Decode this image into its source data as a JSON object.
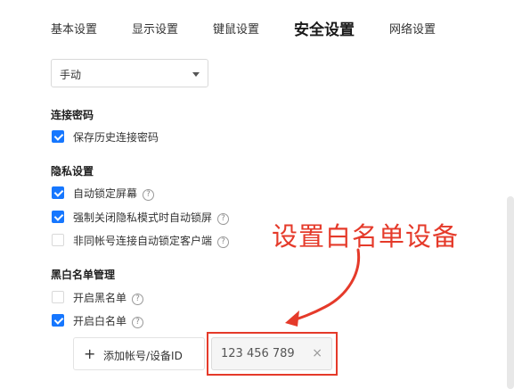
{
  "tabs": [
    {
      "label": "基本设置"
    },
    {
      "label": "显示设置"
    },
    {
      "label": "键鼠设置"
    },
    {
      "label": "安全设置"
    },
    {
      "label": "网络设置"
    }
  ],
  "mode_select": {
    "value": "手动"
  },
  "sections": {
    "connection_password": {
      "title": "连接密码",
      "items": [
        {
          "label": "保存历史连接密码",
          "checked": true
        }
      ]
    },
    "privacy": {
      "title": "隐私设置",
      "items": [
        {
          "label": "自动锁定屏幕",
          "checked": true,
          "help": "?"
        },
        {
          "label": "强制关闭隐私模式时自动锁屏",
          "checked": true,
          "help": "?"
        },
        {
          "label": "非同帐号连接自动锁定客户端",
          "checked": false,
          "help": "?"
        }
      ]
    },
    "blackwhite": {
      "title": "黑白名单管理",
      "items": [
        {
          "label": "开启黑名单",
          "checked": false,
          "help": "?"
        },
        {
          "label": "开启白名单",
          "checked": true,
          "help": "?"
        }
      ]
    }
  },
  "whitelist": {
    "add_label": "添加帐号/设备ID",
    "add_icon": "+",
    "entries": [
      {
        "id": "123 456 789",
        "remove": "×"
      }
    ]
  },
  "annotation": {
    "text": "设置白名单设备",
    "color": "#e53a2a"
  },
  "colors": {
    "accent": "#1677ff"
  }
}
